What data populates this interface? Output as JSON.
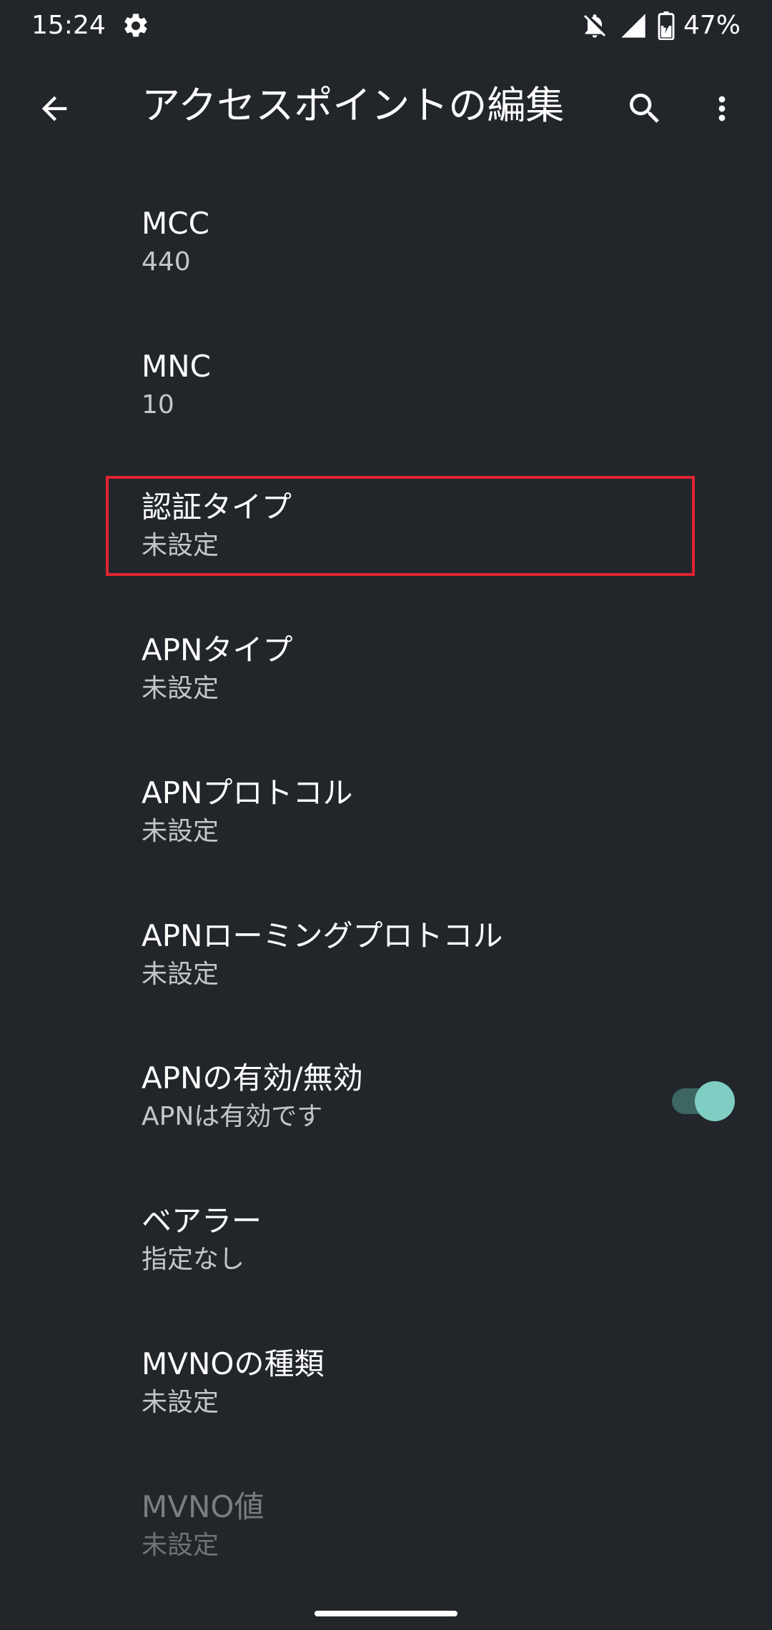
{
  "status_bar": {
    "time": "15:24",
    "battery_percent": "47%",
    "icons": [
      "gear-icon",
      "notifications-off-icon",
      "signal-icon",
      "battery-charging-icon"
    ]
  },
  "app_bar": {
    "title": "アクセスポイントの編集",
    "icons": [
      "back-arrow-icon",
      "search-icon",
      "more-vert-icon"
    ]
  },
  "items": [
    {
      "title": "MCC",
      "summary": "440"
    },
    {
      "title": "MNC",
      "summary": "10"
    },
    {
      "title": "認証タイプ",
      "summary": "未設定"
    },
    {
      "title": "APNタイプ",
      "summary": "未設定"
    },
    {
      "title": "APNプロトコル",
      "summary": "未設定"
    },
    {
      "title": "APNローミングプロトコル",
      "summary": "未設定"
    },
    {
      "title": "APNの有効/無効",
      "summary": "APNは有効です",
      "toggle_on": true
    },
    {
      "title": "ベアラー",
      "summary": "指定なし"
    },
    {
      "title": "MVNOの種類",
      "summary": "未設定"
    },
    {
      "title": "MVNO値",
      "summary": "未設定",
      "disabled": true
    }
  ],
  "colors": {
    "background": "#22262b",
    "highlight": "#e0242f",
    "toggle_accent": "#7fcdc3"
  }
}
